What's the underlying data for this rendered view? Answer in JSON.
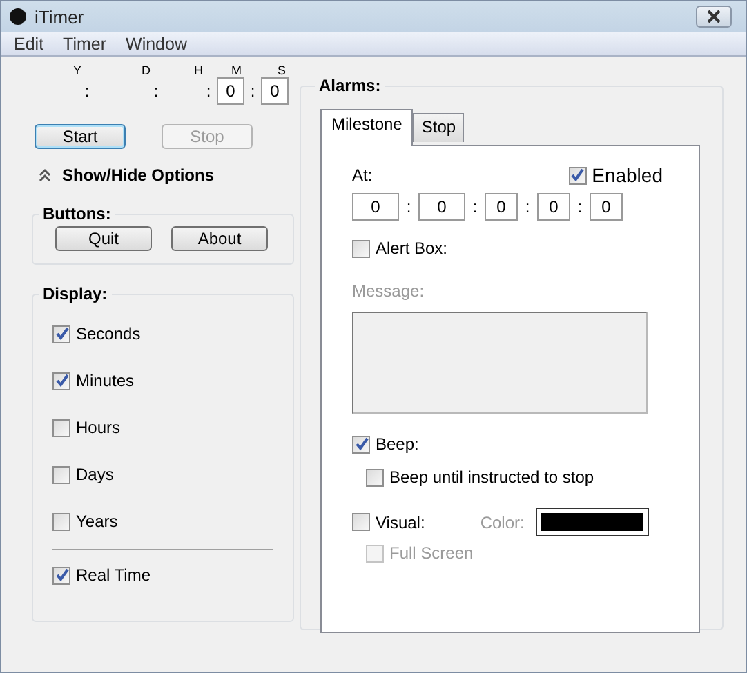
{
  "window": {
    "title": "iTimer"
  },
  "menu": [
    "Edit",
    "Timer",
    "Window"
  ],
  "timer": [
    {
      "unit": "Y",
      "separator": ":"
    },
    {
      "unit": "D",
      "separator": ":"
    },
    {
      "unit": "H",
      "separator": ":"
    },
    {
      "unit": "M",
      "value": "0",
      "separator": ":"
    },
    {
      "unit": "S",
      "value": "0"
    }
  ],
  "controls": [
    {
      "label": "Start",
      "disabled": false
    },
    {
      "label": "Stop",
      "disabled": true
    }
  ],
  "options_toggle": {
    "label": "Show/Hide Options",
    "expanded": true
  },
  "buttons_group": {
    "title": "Buttons:",
    "buttons": [
      "Quit",
      "About"
    ]
  },
  "display_group": {
    "title": "Display:",
    "items": [
      {
        "label": "Seconds",
        "checked": true
      },
      {
        "label": "Minutes",
        "checked": true
      },
      {
        "label": "Hours",
        "checked": false
      },
      {
        "label": "Days",
        "checked": false
      },
      {
        "label": "Years",
        "checked": false
      }
    ],
    "real_time": {
      "label": "Real Time",
      "checked": true
    }
  },
  "alarms": {
    "title": "Alarms:",
    "tabs": [
      {
        "label": "Milestone",
        "selected": true
      },
      {
        "label": "Stop",
        "selected": false
      }
    ],
    "at_label": "At:",
    "enabled": {
      "label": "Enabled",
      "checked": true
    },
    "at_fields": [
      {
        "value": "0"
      },
      {
        "value": "0"
      },
      {
        "value": "0"
      },
      {
        "value": "0"
      },
      {
        "value": "0"
      }
    ],
    "at_separators": [
      ":",
      ":",
      ":",
      ":"
    ],
    "alert_box": {
      "label": "Alert Box:",
      "checked": false
    },
    "message": {
      "label": "Message:",
      "disabled": true
    },
    "beep": {
      "label": "Beep:",
      "checked": true
    },
    "beep_until": {
      "label": "Beep until instructed to stop",
      "checked": false
    },
    "visual": {
      "label": "Visual:",
      "checked": false
    },
    "color": {
      "label": "Color:",
      "color": "#000000",
      "disabled": true
    },
    "full_screen": {
      "label": "Full Screen",
      "checked": false,
      "disabled": true
    }
  }
}
